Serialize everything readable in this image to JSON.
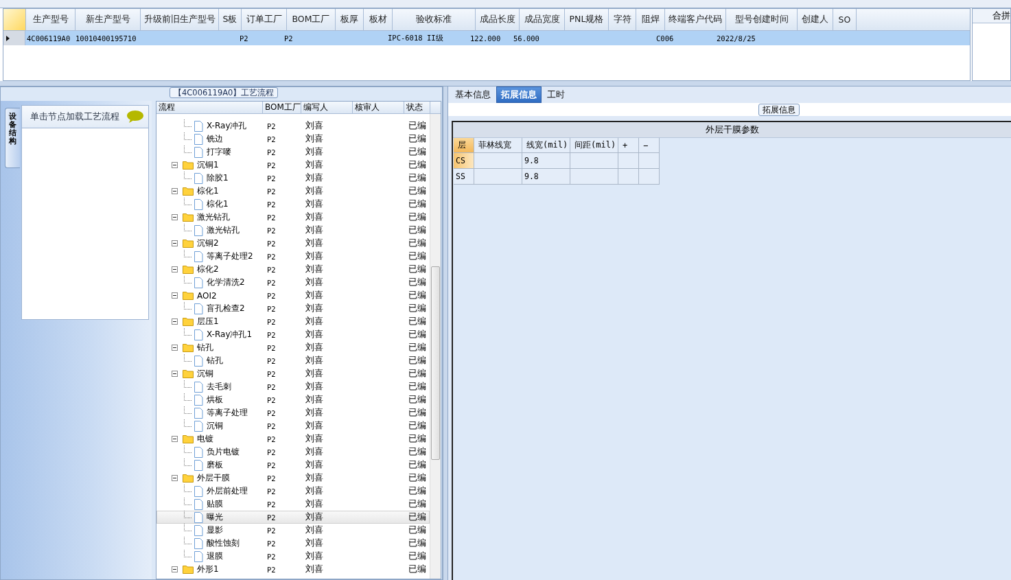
{
  "model_grid": {
    "columns": [
      "生产型号",
      "新生产型号",
      "升级前旧生产型号",
      "S板",
      "订单工厂",
      "BOM工厂",
      "板厚",
      "板材",
      "验收标准",
      "成品长度",
      "成品宽度",
      "PNL规格",
      "字符",
      "阻焊",
      "终端客户代码",
      "型号创建时间",
      "创建人",
      "SO"
    ],
    "rows": [
      {
        "selected": true,
        "cells": [
          "4C006119A0",
          "10010400195710",
          "",
          "",
          "P2",
          "P2",
          "",
          "",
          "IPC-6018 II级",
          "122.000",
          "56.000",
          "",
          "",
          "",
          "C006",
          "2022/8/25",
          "",
          ""
        ]
      }
    ]
  },
  "merge_panel": {
    "header": "合拼"
  },
  "side_tab": {
    "label": "设备结构"
  },
  "node_panel": {
    "hint": "单击节点加载工艺流程"
  },
  "flow_group": {
    "title": "【4C006119A0】工艺流程"
  },
  "flow_tree": {
    "columns": [
      "流程",
      "BOM工厂",
      "编写人",
      "核审人",
      "状态"
    ],
    "continued_children": [
      {
        "label": "X-Ray冲孔",
        "bom": "P2",
        "writer": "刘喜",
        "status": "已编",
        "selected": false
      },
      {
        "label": "铣边",
        "bom": "P2",
        "writer": "刘喜",
        "status": "已编",
        "selected": false
      },
      {
        "label": "打字嘜",
        "bom": "P2",
        "writer": "刘喜",
        "status": "已编",
        "selected": false
      }
    ],
    "nodes": [
      {
        "label": "沉铜1",
        "bom": "P2",
        "writer": "刘喜",
        "status": "已编",
        "selected": false,
        "expanded": true,
        "children": [
          {
            "label": "除胶1",
            "bom": "P2",
            "writer": "刘喜",
            "status": "已编",
            "selected": false
          }
        ]
      },
      {
        "label": "棕化1",
        "bom": "P2",
        "writer": "刘喜",
        "status": "已编",
        "selected": false,
        "expanded": true,
        "children": [
          {
            "label": "棕化1",
            "bom": "P2",
            "writer": "刘喜",
            "status": "已编",
            "selected": false
          }
        ]
      },
      {
        "label": "激光钻孔",
        "bom": "P2",
        "writer": "刘喜",
        "status": "已编",
        "selected": false,
        "expanded": true,
        "children": [
          {
            "label": "激光钻孔",
            "bom": "P2",
            "writer": "刘喜",
            "status": "已编",
            "selected": false
          }
        ]
      },
      {
        "label": "沉铜2",
        "bom": "P2",
        "writer": "刘喜",
        "status": "已编",
        "selected": false,
        "expanded": true,
        "children": [
          {
            "label": "等离子处理2",
            "bom": "P2",
            "writer": "刘喜",
            "status": "已编",
            "selected": false
          }
        ]
      },
      {
        "label": "棕化2",
        "bom": "P2",
        "writer": "刘喜",
        "status": "已编",
        "selected": false,
        "expanded": true,
        "children": [
          {
            "label": "化学清洗2",
            "bom": "P2",
            "writer": "刘喜",
            "status": "已编",
            "selected": false
          }
        ]
      },
      {
        "label": "AOI2",
        "bom": "P2",
        "writer": "刘喜",
        "status": "已编",
        "selected": false,
        "expanded": true,
        "children": [
          {
            "label": "盲孔检查2",
            "bom": "P2",
            "writer": "刘喜",
            "status": "已编",
            "selected": false
          }
        ]
      },
      {
        "label": "层压1",
        "bom": "P2",
        "writer": "刘喜",
        "status": "已编",
        "selected": false,
        "expanded": true,
        "children": [
          {
            "label": "X-Ray冲孔1",
            "bom": "P2",
            "writer": "刘喜",
            "status": "已编",
            "selected": false
          }
        ]
      },
      {
        "label": "钻孔",
        "bom": "P2",
        "writer": "刘喜",
        "status": "已编",
        "selected": false,
        "expanded": true,
        "children": [
          {
            "label": "钻孔",
            "bom": "P2",
            "writer": "刘喜",
            "status": "已编",
            "selected": false
          }
        ]
      },
      {
        "label": "沉铜",
        "bom": "P2",
        "writer": "刘喜",
        "status": "已编",
        "selected": false,
        "expanded": true,
        "children": [
          {
            "label": "去毛刺",
            "bom": "P2",
            "writer": "刘喜",
            "status": "已编",
            "selected": false
          },
          {
            "label": "烘板",
            "bom": "P2",
            "writer": "刘喜",
            "status": "已编",
            "selected": false
          },
          {
            "label": "等离子处理",
            "bom": "P2",
            "writer": "刘喜",
            "status": "已编",
            "selected": false
          },
          {
            "label": "沉铜",
            "bom": "P2",
            "writer": "刘喜",
            "status": "已编",
            "selected": false
          }
        ]
      },
      {
        "label": "电镀",
        "bom": "P2",
        "writer": "刘喜",
        "status": "已编",
        "selected": false,
        "expanded": true,
        "children": [
          {
            "label": "负片电镀",
            "bom": "P2",
            "writer": "刘喜",
            "status": "已编",
            "selected": false
          },
          {
            "label": "磨板",
            "bom": "P2",
            "writer": "刘喜",
            "status": "已编",
            "selected": false
          }
        ]
      },
      {
        "label": "外层干膜",
        "bom": "P2",
        "writer": "刘喜",
        "status": "已编",
        "selected": false,
        "expanded": true,
        "children": [
          {
            "label": "外层前处理",
            "bom": "P2",
            "writer": "刘喜",
            "status": "已编",
            "selected": false
          },
          {
            "label": "贴膜",
            "bom": "P2",
            "writer": "刘喜",
            "status": "已编",
            "selected": false
          },
          {
            "label": "曝光",
            "bom": "P2",
            "writer": "刘喜",
            "status": "已编",
            "selected": true
          },
          {
            "label": "显影",
            "bom": "P2",
            "writer": "刘喜",
            "status": "已编",
            "selected": false
          },
          {
            "label": "酸性蚀刻",
            "bom": "P2",
            "writer": "刘喜",
            "status": "已编",
            "selected": false
          },
          {
            "label": "退膜",
            "bom": "P2",
            "writer": "刘喜",
            "status": "已编",
            "selected": false
          }
        ]
      },
      {
        "label": "外形1",
        "bom": "P2",
        "writer": "刘喜",
        "status": "已编",
        "selected": false,
        "expanded": true
      }
    ]
  },
  "detail_tabs": [
    {
      "label": "基本信息",
      "selected": false
    },
    {
      "label": "拓展信息",
      "selected": true
    },
    {
      "label": "工时",
      "selected": false
    }
  ],
  "ext_group": {
    "title": "拓展信息",
    "section": "外层干膜参数",
    "columns": [
      "层",
      "菲林线宽",
      "线宽(mil)",
      "间距(mil)",
      "+",
      "−"
    ],
    "rows": [
      {
        "selected": true,
        "cells": [
          "CS",
          "",
          "9.8",
          "",
          "",
          ""
        ]
      },
      {
        "selected": false,
        "cells": [
          "SS",
          "",
          "9.8",
          "",
          "",
          ""
        ]
      }
    ]
  }
}
